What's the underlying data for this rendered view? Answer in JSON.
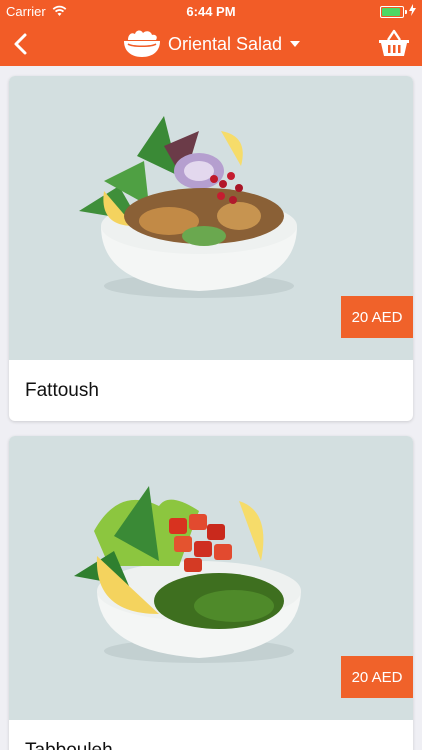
{
  "status": {
    "carrier": "Carrier",
    "time": "6:44 PM",
    "battery_level": 0.92
  },
  "navbar": {
    "title": "Oriental Salad",
    "back_icon": "chevron-left-icon",
    "logo_icon": "salad-bowl-icon",
    "dropdown_icon": "caret-down-icon",
    "cart_icon": "basket-icon"
  },
  "colors": {
    "brand": "#f25c27",
    "badge": "#f0622a",
    "background": "#efeff4"
  },
  "products": [
    {
      "name": "Fattoush",
      "price": "20 AED"
    },
    {
      "name": "Tabbouleh",
      "price": "20 AED"
    }
  ]
}
